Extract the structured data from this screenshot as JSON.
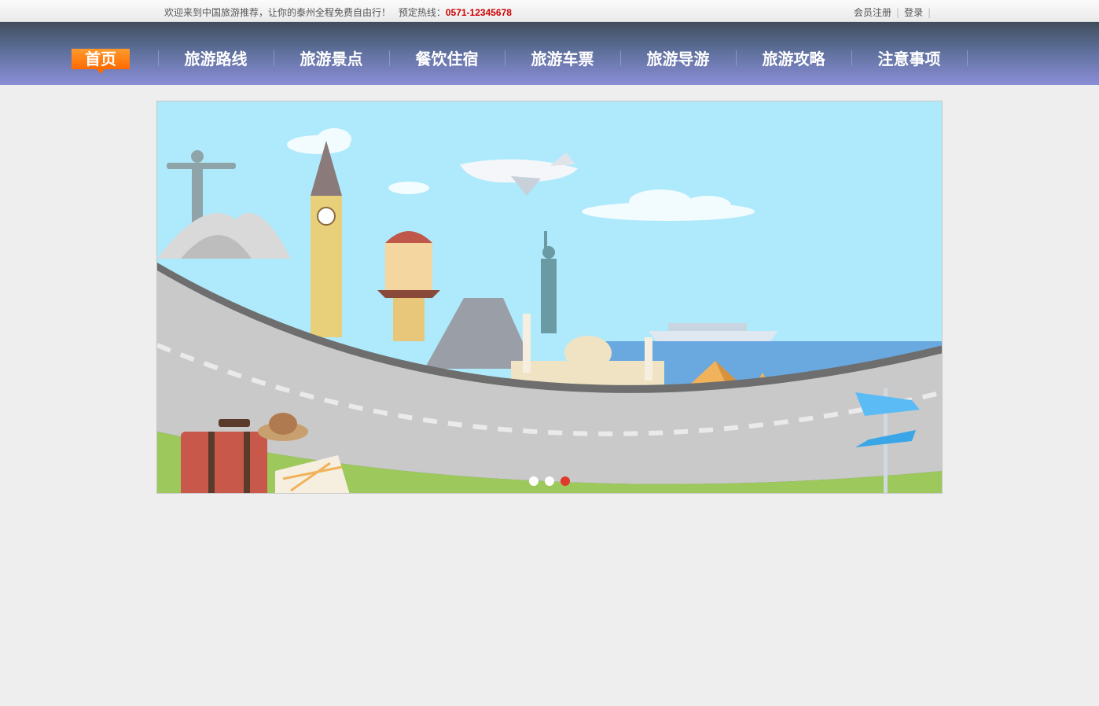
{
  "topbar": {
    "welcome": "欢迎来到中国旅游推荐，让你的泰州全程免费自由行！",
    "hotline_label": "预定热线：",
    "hotline": "0571-12345678",
    "register": "会员注册",
    "login": "登录",
    "separator": "|"
  },
  "nav": {
    "items": [
      "首页",
      "旅游路线",
      "旅游景点",
      "餐饮住宿",
      "旅游车票",
      "旅游导游",
      "旅游攻略",
      "注意事项"
    ],
    "active_index": 0
  },
  "banner": {
    "slide_count": 3,
    "active_slide": 3
  },
  "colors": {
    "accent": "#ff7a10",
    "hotline": "#cc0000",
    "nav_top": "#414d5c",
    "nav_bottom": "#8b8ed6",
    "dot_active": "#e03a2e"
  }
}
